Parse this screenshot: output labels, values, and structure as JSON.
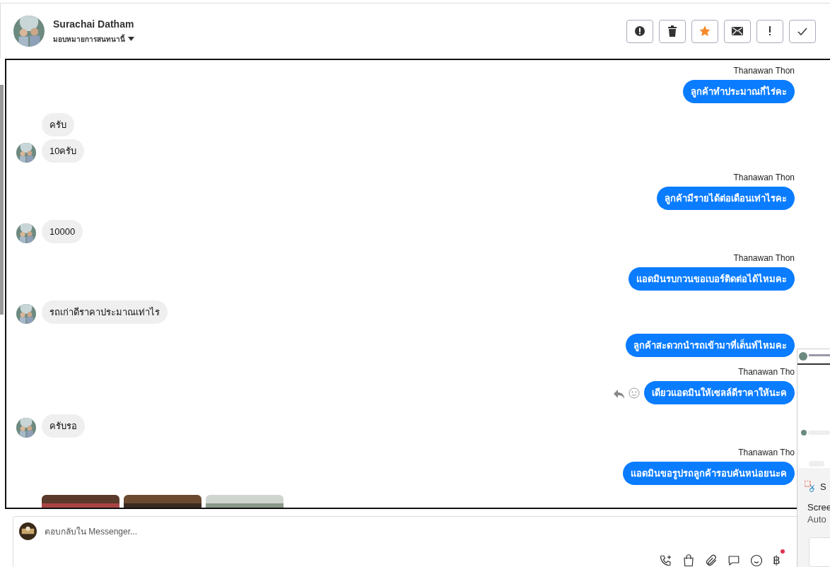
{
  "header": {
    "name": "Surachai Datham",
    "assign": "มอบหมายการสนทนานี้",
    "actions": [
      {
        "kind": "alert",
        "on": false
      },
      {
        "kind": "trash",
        "on": false
      },
      {
        "kind": "star",
        "on": true
      },
      {
        "kind": "mail",
        "on": false
      },
      {
        "kind": "important",
        "on": false
      },
      {
        "kind": "done",
        "on": false
      }
    ]
  },
  "groups": [
    {
      "kind": "outgoing",
      "sender": "Thanawan Thon",
      "messages": [
        {
          "kind": "text",
          "text": "ลูกค้าทำประมาณกี่ไร่คะ"
        }
      ]
    },
    {
      "kind": "incoming",
      "messages": [
        {
          "kind": "text",
          "text": "ครับ"
        },
        {
          "kind": "text",
          "text": "10ครับ"
        }
      ]
    },
    {
      "kind": "outgoing",
      "sender": "Thanawan Thon",
      "messages": [
        {
          "kind": "text",
          "text": "ลูกค้ามีรายได้ต่อเดือนเท่าไรคะ"
        }
      ]
    },
    {
      "kind": "incoming",
      "messages": [
        {
          "kind": "text",
          "text": "10000"
        }
      ]
    },
    {
      "kind": "outgoing",
      "sender": "Thanawan Thon",
      "messages": [
        {
          "kind": "text",
          "text": "แอดมินรบกวนขอเบอร์ติดต่อได้ไหมคะ"
        }
      ]
    },
    {
      "kind": "incoming",
      "messages": [
        {
          "kind": "text",
          "text": "รถเก่าดีราคาประมาณเท่าไร"
        }
      ]
    },
    {
      "kind": "outgoing",
      "messages": [
        {
          "kind": "text",
          "text": "ลูกค้าสะดวกนำรถเข้ามาที่เต็นท์ไหมคะ"
        }
      ]
    },
    {
      "kind": "outgoing",
      "sender": "Thanawan Tho",
      "messages": [
        {
          "kind": "text",
          "text": "เดียวแอดมินให้เซลล์ดีราคาให้นะค",
          "hovered": true
        }
      ]
    },
    {
      "kind": "incoming",
      "messages": [
        {
          "kind": "text",
          "text": "ครับรอ"
        }
      ]
    },
    {
      "kind": "outgoing",
      "sender": "Thanawan Tho",
      "messages": [
        {
          "kind": "text",
          "text": "แอดมินขอรูปรถลูกค้ารอบคันหน่อยนะค"
        }
      ]
    },
    {
      "kind": "incoming",
      "messages": [
        {
          "kind": "photos"
        }
      ]
    }
  ],
  "composer": {
    "placeholder": "ตอบกลับใน Messenger...",
    "baht": "฿"
  },
  "notification": {
    "app": "S",
    "title": "Scree",
    "body": "Auto"
  }
}
